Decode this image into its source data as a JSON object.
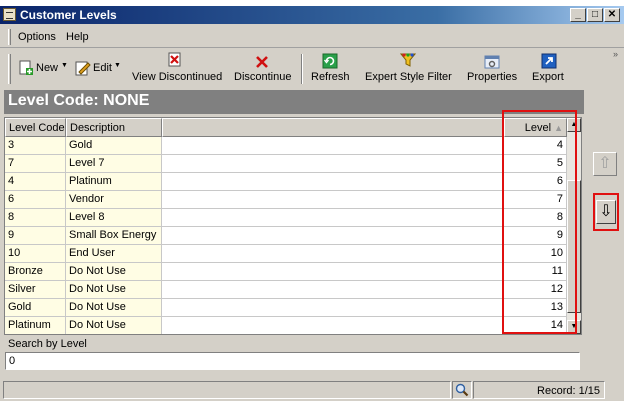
{
  "window": {
    "title": "Customer Levels"
  },
  "title_buttons": {
    "minimize": "_",
    "maximize": "□",
    "close": "✕"
  },
  "menu": [
    {
      "label": "Options"
    },
    {
      "label": "Help"
    }
  ],
  "toolbar": {
    "new_label": "New",
    "edit_label": "Edit",
    "view_discontinued_label": "View Discontinued",
    "discontinue_label": "Discontinue",
    "refresh_label": "Refresh",
    "expert_filter_label": "Expert Style Filter",
    "properties_label": "Properties",
    "export_label": "Export",
    "overflow_glyph": "»"
  },
  "header": {
    "title": "Level Code: NONE"
  },
  "grid": {
    "columns": {
      "code": "Level Code",
      "description": "Description",
      "level": "Level"
    },
    "rows": [
      {
        "code": "3",
        "description": "Gold",
        "level": "4"
      },
      {
        "code": "7",
        "description": "Level 7",
        "level": "5"
      },
      {
        "code": "4",
        "description": "Platinum",
        "level": "6"
      },
      {
        "code": "6",
        "description": "Vendor",
        "level": "7"
      },
      {
        "code": "8",
        "description": "Level 8",
        "level": "8"
      },
      {
        "code": "9",
        "description": "Small Box Energy",
        "level": "9"
      },
      {
        "code": "10",
        "description": "End User",
        "level": "10"
      },
      {
        "code": "Bronze",
        "description": "Do Not Use",
        "level": "11"
      },
      {
        "code": "Silver",
        "description": "Do Not Use",
        "level": "12"
      },
      {
        "code": "Gold",
        "description": "Do Not Use",
        "level": "13"
      },
      {
        "code": "Platinum",
        "description": "Do Not Use",
        "level": "14"
      }
    ]
  },
  "search": {
    "label": "Search by Level",
    "value": "0"
  },
  "status": {
    "record": "Record: 1/15"
  },
  "nav": {
    "up_glyph": "⇧",
    "down_glyph": "⇩"
  },
  "colors": {
    "title_bar": "#0a246a",
    "highlight": "#e01010",
    "row_tint": "#fffde4"
  }
}
